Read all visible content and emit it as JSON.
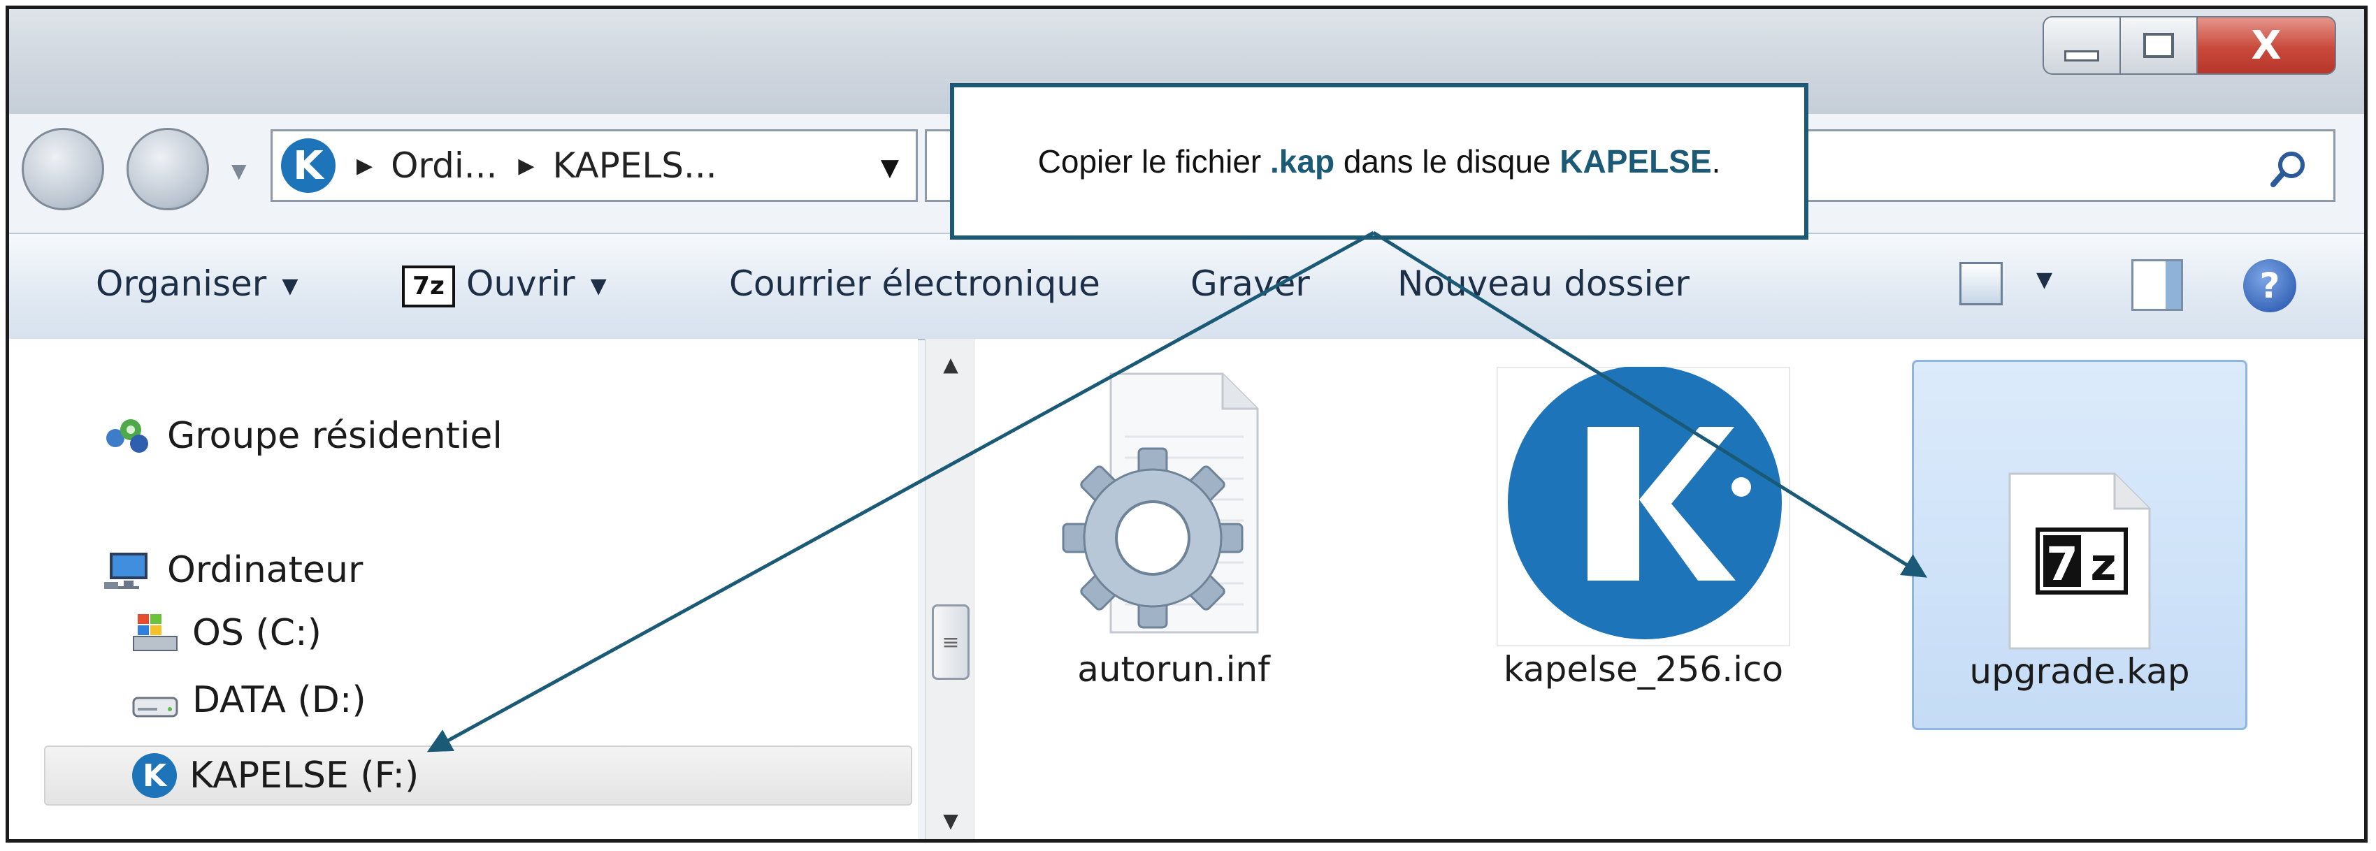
{
  "window": {
    "minimize_glyph": "",
    "maximize_glyph": "",
    "close_glyph": "X"
  },
  "address_bar": {
    "breadcrumb": [
      "Ordi...",
      "KAPELS..."
    ]
  },
  "toolbar": {
    "organiser": "Organiser",
    "ouvrir_logo": "7z",
    "ouvrir": "Ouvrir",
    "courrier": "Courrier électronique",
    "graver": "Graver",
    "nouveau_dossier": "Nouveau dossier",
    "help_glyph": "?"
  },
  "navigation": {
    "groupe": "Groupe résidentiel",
    "ordinateur": "Ordinateur",
    "drives": [
      "OS (C:)",
      "DATA (D:)",
      "KAPELSE (F:)"
    ]
  },
  "files": [
    {
      "name": "autorun.inf",
      "icon": "settings-file-icon"
    },
    {
      "name": "kapelse_256.ico",
      "icon": "kapelse-logo-icon"
    },
    {
      "name": "upgrade.kap",
      "icon": "7z-archive-icon",
      "selected": true
    }
  ],
  "kapelse_logo_letter": "K",
  "callout": {
    "text_before": "Copier le fichier ",
    "highlight1": ".kap",
    "text_middle": " dans le disque ",
    "highlight2": "KAPELSE",
    "text_after": "."
  },
  "colors": {
    "callout_accent": "#1b5a77",
    "kapelse_blue": "#1e74b8",
    "selection": "#c5dcf6",
    "close_button": "#c94a3c"
  }
}
